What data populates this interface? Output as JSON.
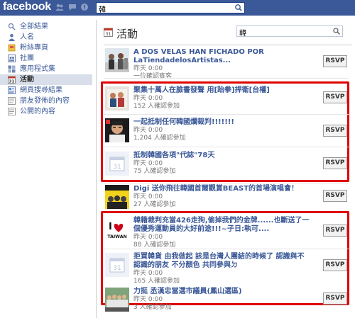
{
  "topbar": {
    "logo": "facebook",
    "search_value": "韓"
  },
  "sidebar": {
    "items": [
      {
        "label": "全部結果",
        "icon": "search-icon"
      },
      {
        "label": "人名",
        "icon": "person-icon"
      },
      {
        "label": "粉絲專頁",
        "icon": "flag-icon"
      },
      {
        "label": "社團",
        "icon": "group-icon"
      },
      {
        "label": "應用程式集",
        "icon": "apps-icon"
      },
      {
        "label": "活動",
        "icon": "calendar-icon"
      },
      {
        "label": "網頁搜尋結果",
        "icon": "web-icon"
      },
      {
        "label": "朋友發佈的內容",
        "icon": "friends-post-icon"
      },
      {
        "label": "公開的內容",
        "icon": "public-post-icon"
      }
    ]
  },
  "main": {
    "title": "活動",
    "search_value": "韓",
    "rsvp_label": "RSVP",
    "events": [
      {
        "title": "A DOS VELAS HAN FICHADO POR LaTiendadelosArtistas...",
        "time": "昨天 0:00",
        "count": "一位確認賓客"
      },
      {
        "title": "聚集十萬人在臉書發聲 用[跆拳]捍衛[台權]",
        "time": "昨天 0:00",
        "count": "152 人確認參加"
      },
      {
        "title": "一起抵制任何韓國爛裁判!!!!!!!",
        "time": "昨天 0:00",
        "count": "1,204 人確認參加"
      },
      {
        "title": "抵制韓國各項\"代誌\"78天",
        "time": "昨天 0:00",
        "count": "75 人確認參加"
      },
      {
        "title": "Digi 送你飛往韓國首爾觀賞BEAST的首場演唱會！",
        "time": "昨天 0:00",
        "count": "27 人確認參加"
      },
      {
        "title": "韓籍裁判充當426走狗,偷掉我們的金牌......也斷送了一個優秀運動員的大好前途!!!~子日:執可....",
        "time": "昨天 0:00",
        "count": "88 人確認參加"
      },
      {
        "title": "拒買韓貨 由我做起 該是台灣人團結的時候了 認識與不認識的朋友 不分顏色 共同參與ㄉ",
        "time": "昨天 0:00",
        "count": "165 人確認參加"
      },
      {
        "title": "力挺 丞漢忠當選市議員(鳳山選區)",
        "time": "昨天 0:00",
        "count": "3 人確認參加"
      }
    ],
    "calendar_thumb_number": "31",
    "taiwan_thumb_text": "TAIWAN",
    "colors": {
      "highlight_border": "#e00000",
      "brand": "#3b5998"
    }
  }
}
